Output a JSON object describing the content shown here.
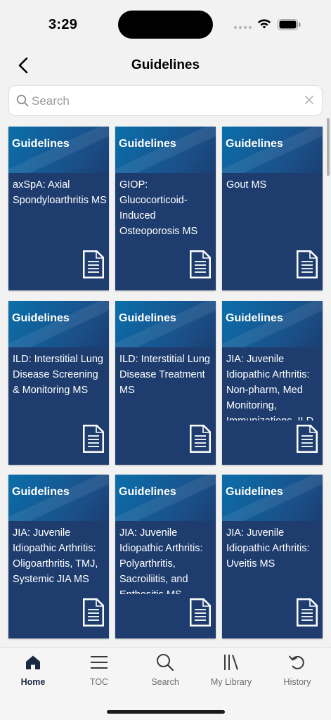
{
  "status_bar": {
    "time": "3:29"
  },
  "header": {
    "title": "Guidelines"
  },
  "search": {
    "placeholder": "Search",
    "value": ""
  },
  "card_header_label": "Guidelines",
  "cards": [
    {
      "title": "axSpA: Axial Spondyloarthritis MS"
    },
    {
      "title": "GIOP: Glucocorticoid-Induced Osteoporosis MS"
    },
    {
      "title": "Gout MS"
    },
    {
      "title": "ILD: Interstitial Lung Disease Screening & Monitoring MS"
    },
    {
      "title": "ILD: Interstitial Lung Disease Treatment MS"
    },
    {
      "title": "JIA: Juvenile Idiopathic Arthritis: Non-pharm, Med Monitoring, Immunizations, ILD MS"
    },
    {
      "title": "JIA: Juvenile Idiopathic Arthritis: Oligoarthritis, TMJ, Systemic JIA MS"
    },
    {
      "title": "JIA: Juvenile Idiopathic Arthritis: Polyarthritis, Sacroiliitis, and Enthesitis MS"
    },
    {
      "title": "JIA: Juvenile Idiopathic Arthritis: Uveitis MS"
    }
  ],
  "tabs": [
    {
      "label": "Home",
      "icon": "home-icon",
      "active": true
    },
    {
      "label": "TOC",
      "icon": "list-icon",
      "active": false
    },
    {
      "label": "Search",
      "icon": "search-icon",
      "active": false
    },
    {
      "label": "My Library",
      "icon": "library-icon",
      "active": false
    },
    {
      "label": "History",
      "icon": "history-icon",
      "active": false
    }
  ],
  "colors": {
    "card_body": "#1e3d6e",
    "card_header": "#0b6fa9",
    "active_tab": "#1b2a44",
    "inactive_tab": "#6d6d6d"
  }
}
